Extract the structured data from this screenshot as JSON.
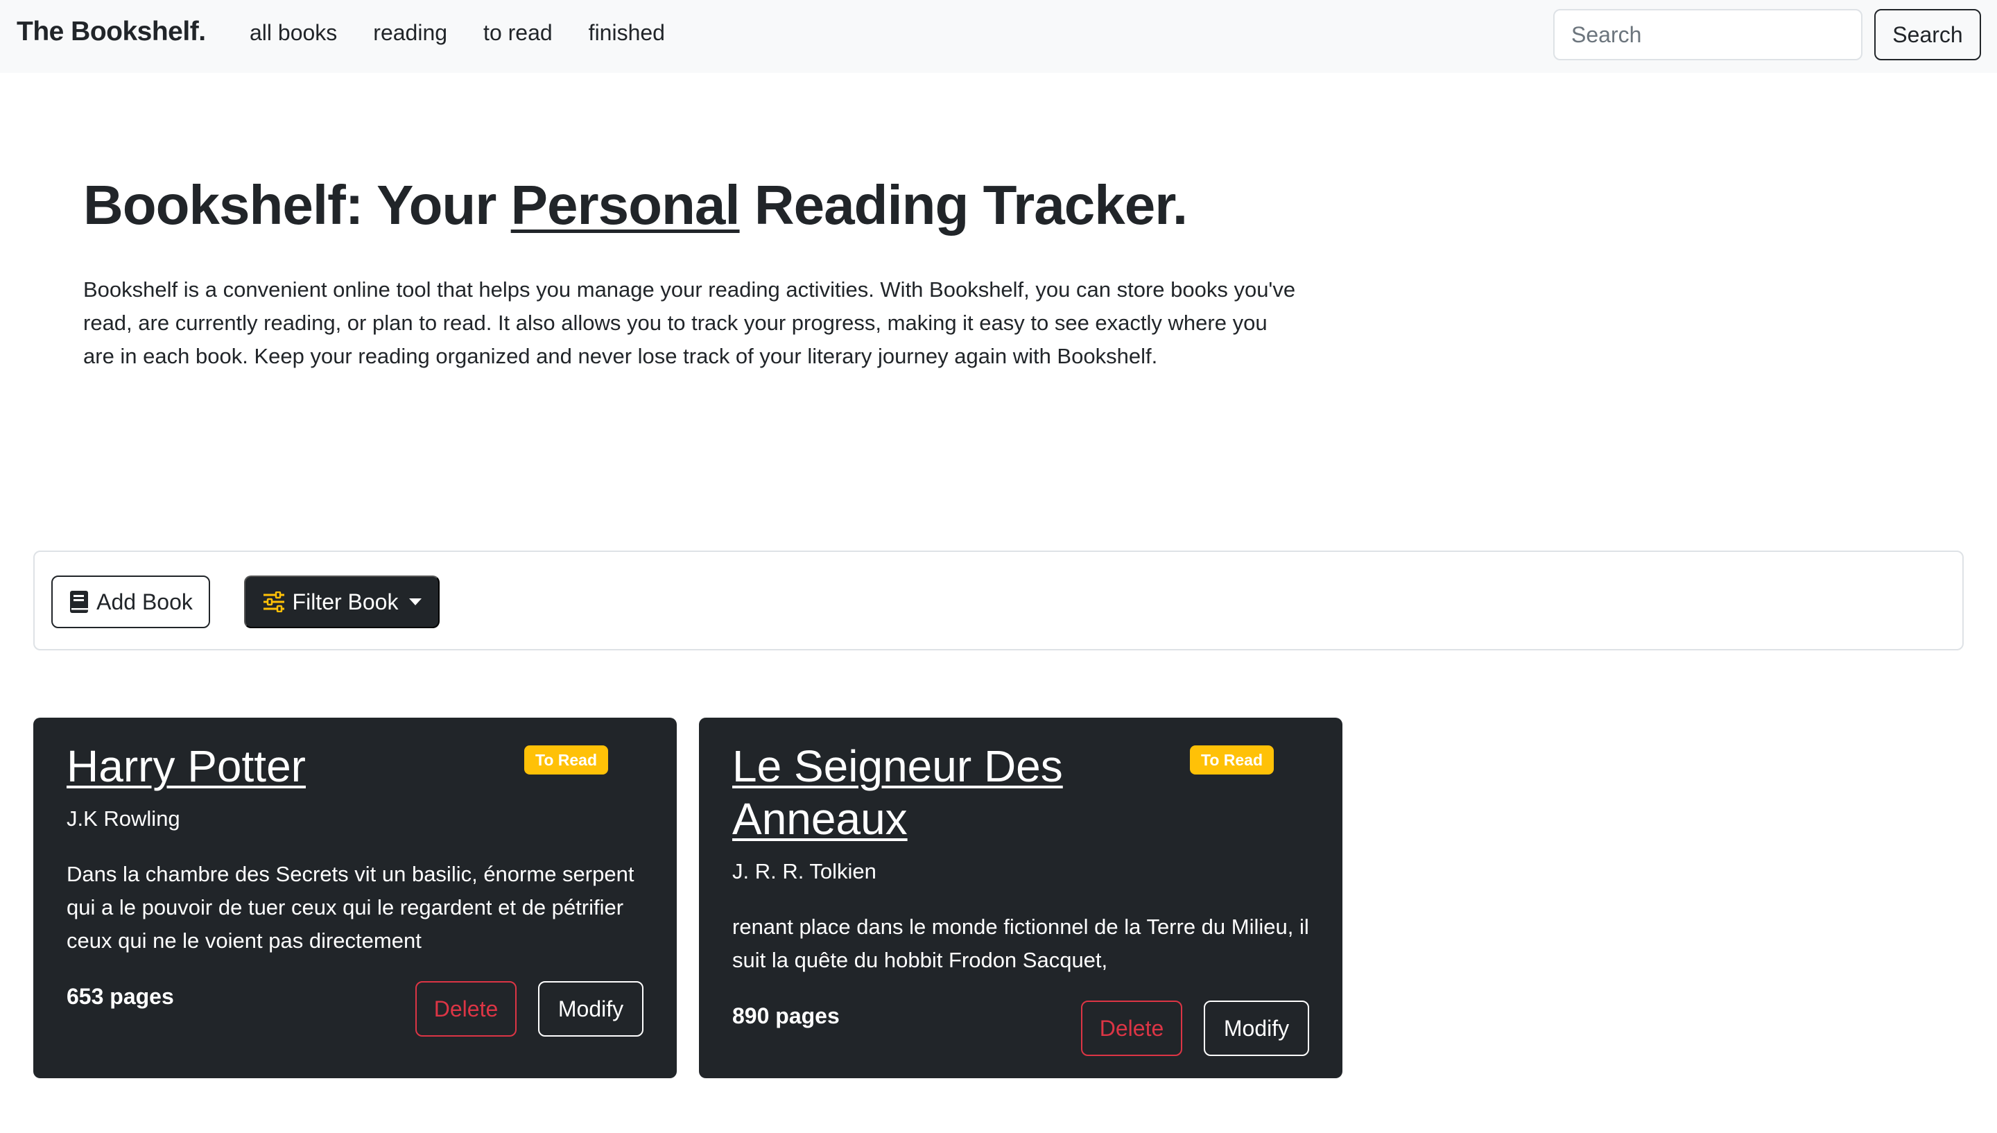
{
  "navbar": {
    "brand": "The Bookshelf.",
    "links": [
      "all books",
      "reading",
      "to read",
      "finished"
    ],
    "search_placeholder": "Search",
    "search_button": "Search"
  },
  "hero": {
    "title_before": "Bookshelf: Your ",
    "title_underlined": "Personal",
    "title_after": " Reading Tracker.",
    "description": "Bookshelf is a convenient online tool that helps you manage your reading activities. With Bookshelf, you can store books you've read, are currently reading, or plan to read. It also allows you to track your progress, making it easy to see exactly where you are in each book. Keep your reading organized and never lose track of your literary journey again with Bookshelf."
  },
  "toolbar": {
    "add_book": "Add Book",
    "filter_book": "Filter Book"
  },
  "books": [
    {
      "title": "Harry Potter",
      "status": "To Read",
      "author": "J.K Rowling",
      "description": "Dans la chambre des Secrets vit un basilic, énorme serpent qui a le pouvoir de tuer ceux qui le regardent et de pétrifier ceux qui ne le voient pas directement",
      "pages": "653 pages",
      "delete_label": "Delete",
      "modify_label": "Modify"
    },
    {
      "title": "Le Seigneur Des Anneaux",
      "status": "To Read",
      "author": "J. R. R. Tolkien",
      "description": "renant place dans le monde fictionnel de la Terre du Milieu, il suit la quête du hobbit Frodon Sacquet,",
      "pages": "890 pages",
      "delete_label": "Delete",
      "modify_label": "Modify"
    }
  ],
  "colors": {
    "navbar_bg": "#f8f9fa",
    "dark": "#212529",
    "badge_warning": "#ffc107",
    "danger": "#dc3545"
  },
  "icons": {
    "add_book": "book-icon",
    "filter_book": "sliders-icon",
    "filter_dropdown": "caret-down-icon"
  }
}
